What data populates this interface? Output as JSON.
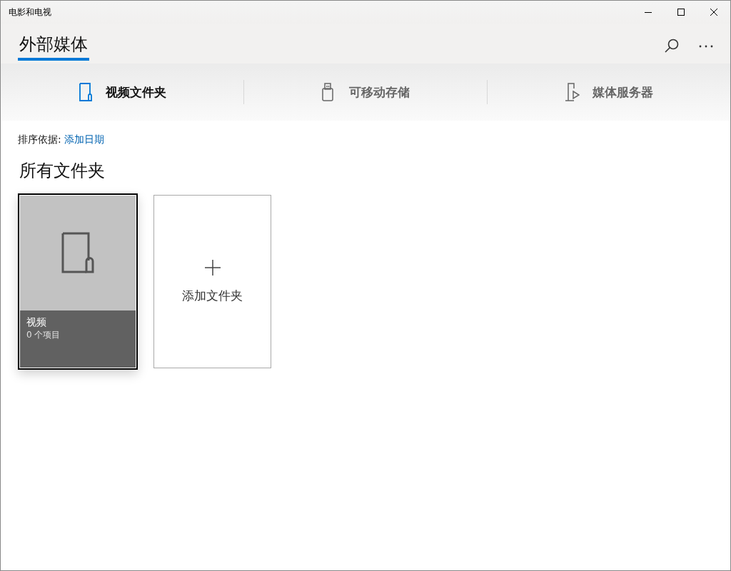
{
  "window": {
    "title": "电影和电视"
  },
  "header": {
    "title": "外部媒体"
  },
  "tabs": [
    {
      "label": "视频文件夹",
      "kind": "folder",
      "selected": true
    },
    {
      "label": "可移动存储",
      "kind": "usb",
      "selected": false
    },
    {
      "label": "媒体服务器",
      "kind": "server",
      "selected": false
    }
  ],
  "sort": {
    "label": "排序依据:",
    "value": "添加日期"
  },
  "section_title": "所有文件夹",
  "folders": [
    {
      "name": "视频",
      "count": "0 个项目",
      "selected": true
    }
  ],
  "add_tile": {
    "label": "添加文件夹"
  }
}
